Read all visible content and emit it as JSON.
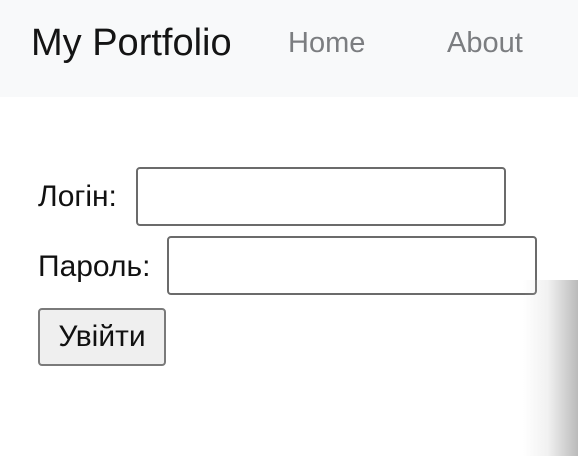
{
  "navbar": {
    "brand": "My Portfolio",
    "links": [
      {
        "label": "Home"
      },
      {
        "label": "About"
      }
    ]
  },
  "login_form": {
    "login_label": "Логін:",
    "login_value": "",
    "password_label": "Пароль:",
    "password_value": "",
    "submit_label": "Увійти"
  }
}
